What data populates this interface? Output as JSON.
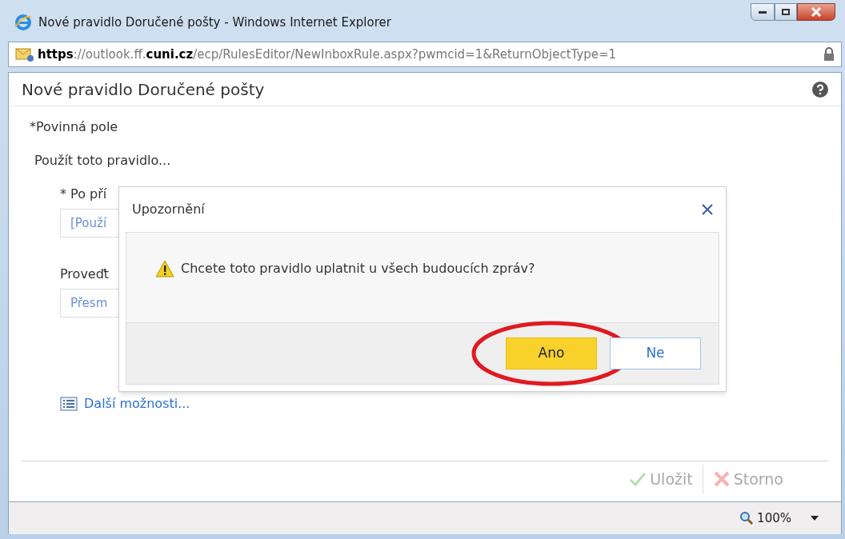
{
  "window": {
    "title": "Nové pravidlo Doručené pošty - Windows Internet Explorer"
  },
  "address_bar": {
    "url": "**https**://outlook.ff.**cuni.cz**/ecp/RulesEditor/NewInboxRule.aspx?pwmcid=1&ReturnObjectType=1"
  },
  "page": {
    "title": "Nové pravidlo Doručené pošty",
    "required_note": "*Povinná pole",
    "section_label": "Použít toto pravidlo...",
    "fields": [
      {
        "label": "* Po pří",
        "value": "[Použí"
      },
      {
        "label": "Proveďt",
        "value": "Přesm"
      }
    ],
    "more_options_link": "Další možnosti...",
    "footer_buttons": [
      {
        "label": "Uložit",
        "kind": "save",
        "disabled": true
      },
      {
        "label": "Storno",
        "kind": "cancel",
        "disabled": true
      }
    ]
  },
  "dialog": {
    "title": "Upozornění",
    "message": "Chcete toto pravidlo uplatnit u všech budoucích zpráv?",
    "buttons": [
      {
        "label": "Ano",
        "kind": "primary",
        "circled": true
      },
      {
        "label": "Ne",
        "kind": "secondary",
        "circled": false
      }
    ]
  },
  "status_bar": {
    "zoom": "100%"
  }
}
